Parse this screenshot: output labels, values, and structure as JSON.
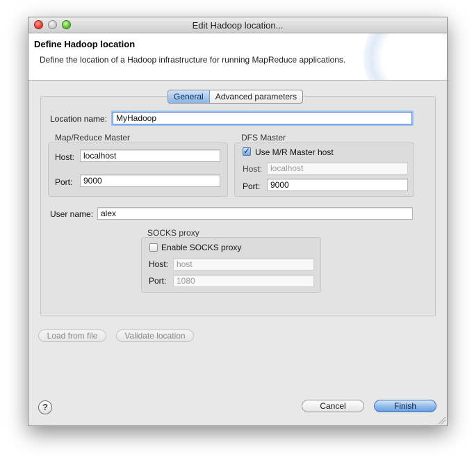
{
  "window": {
    "title": "Edit Hadoop location..."
  },
  "header": {
    "title": "Define Hadoop location",
    "description": "Define the location of a Hadoop infrastructure for running MapReduce applications."
  },
  "tabs": [
    {
      "label": "General",
      "active": true
    },
    {
      "label": "Advanced parameters",
      "active": false
    }
  ],
  "general": {
    "location_name": {
      "label": "Location name:",
      "value": "MyHadoop"
    },
    "mapreduce_master": {
      "title": "Map/Reduce Master",
      "host": {
        "label": "Host:",
        "value": "localhost"
      },
      "port": {
        "label": "Port:",
        "value": "9000"
      }
    },
    "dfs_master": {
      "title": "DFS Master",
      "use_mr_master": {
        "label": "Use M/R Master host",
        "checked": true
      },
      "host": {
        "label": "Host:",
        "value": "localhost"
      },
      "port": {
        "label": "Port:",
        "value": "9000"
      }
    },
    "user_name": {
      "label": "User name:",
      "value": "alex"
    },
    "socks_proxy": {
      "title": "SOCKS proxy",
      "enable": {
        "label": "Enable SOCKS proxy",
        "checked": false
      },
      "host": {
        "label": "Host:",
        "value": "host"
      },
      "port": {
        "label": "Port:",
        "value": "1080"
      }
    }
  },
  "buttons": {
    "load_from_file": "Load from file",
    "validate_location": "Validate location",
    "cancel": "Cancel",
    "finish": "Finish",
    "help": "?"
  },
  "colors": {
    "accent": "#6aa0e2",
    "window_bg": "#e8e8e8"
  }
}
